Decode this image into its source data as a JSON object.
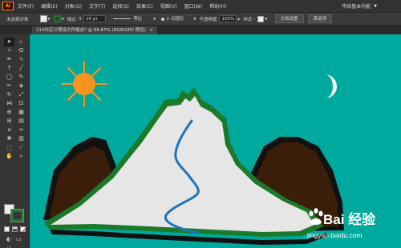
{
  "menubar": {
    "logo": "Ai",
    "items": [
      "文件(F)",
      "编辑(E)",
      "对象(O)",
      "文字(T)",
      "选择(S)",
      "效果(C)",
      "视图(V)",
      "窗口(W)",
      "帮助(H)"
    ],
    "workspace": "传统基本功能"
  },
  "control": {
    "selection": "未选择对象",
    "stroke_label": "描边",
    "stroke_weight": "20 pt",
    "stroke_style": "等比",
    "brush": "3 点圆形",
    "opacity_label": "不透明度",
    "opacity_value": "100%",
    "style_label": "样式",
    "doc_setup": "文档设置",
    "preferences": "首选项"
  },
  "document": {
    "tab_title": "214白定义预设文件格式* @ 66.67% (RGB/GPU 预览)",
    "close": "×"
  },
  "tools": [
    {
      "icon": "selection-tool-icon",
      "glyph": "➤"
    },
    {
      "icon": "direct-selection-tool-icon",
      "glyph": "▹"
    },
    {
      "icon": "magic-wand-tool-icon",
      "glyph": "✧"
    },
    {
      "icon": "lasso-tool-icon",
      "glyph": "ʘ"
    },
    {
      "icon": "pen-tool-icon",
      "glyph": "✒"
    },
    {
      "icon": "curvature-tool-icon",
      "glyph": "∿"
    },
    {
      "icon": "type-tool-icon",
      "glyph": "T"
    },
    {
      "icon": "line-tool-icon",
      "glyph": "╱"
    },
    {
      "icon": "ellipse-tool-icon",
      "glyph": "◯"
    },
    {
      "icon": "paintbrush-tool-icon",
      "glyph": "✎"
    },
    {
      "icon": "pencil-tool-icon",
      "glyph": "✏"
    },
    {
      "icon": "eraser-tool-icon",
      "glyph": "◈"
    },
    {
      "icon": "rotate-tool-icon",
      "glyph": "↻"
    },
    {
      "icon": "scale-tool-icon",
      "glyph": "⤢"
    },
    {
      "icon": "width-tool-icon",
      "glyph": "⋈"
    },
    {
      "icon": "free-transform-tool-icon",
      "glyph": "⊡"
    },
    {
      "icon": "shape-builder-tool-icon",
      "glyph": "⊕"
    },
    {
      "icon": "perspective-grid-tool-icon",
      "glyph": "▦"
    },
    {
      "icon": "mesh-tool-icon",
      "glyph": "⊞"
    },
    {
      "icon": "gradient-tool-icon",
      "glyph": "▤"
    },
    {
      "icon": "eyedropper-tool-icon",
      "glyph": "⌀"
    },
    {
      "icon": "blend-tool-icon",
      "glyph": "∞"
    },
    {
      "icon": "symbol-sprayer-tool-icon",
      "glyph": "✺"
    },
    {
      "icon": "column-graph-tool-icon",
      "glyph": "▥"
    },
    {
      "icon": "artboard-tool-icon",
      "glyph": "⬚"
    },
    {
      "icon": "slice-tool-icon",
      "glyph": "⟋"
    },
    {
      "icon": "hand-tool-icon",
      "glyph": "✋"
    },
    {
      "icon": "zoom-tool-icon",
      "glyph": "⌕"
    }
  ],
  "colors": {
    "canvas": "#00a99d",
    "fill": "#ededed",
    "stroke": "#1b7a2a",
    "sun": "#f7941d",
    "mountain_brown": "#3b1e0a",
    "mountain_snow": "#e6e6e6",
    "river": "#1a75bc"
  },
  "watermark": {
    "brand": "Bai  经验",
    "url": "jingyan.baidu.com"
  }
}
